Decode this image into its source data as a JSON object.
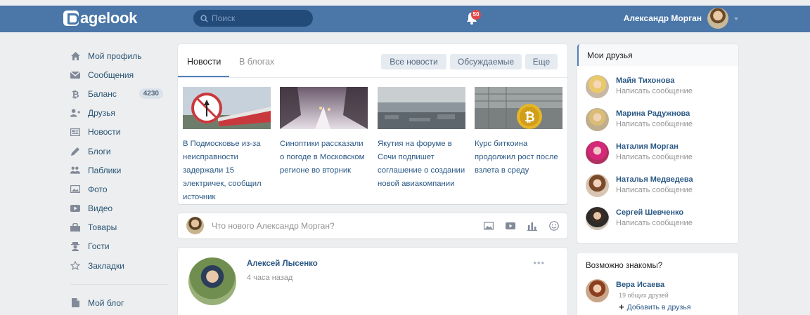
{
  "header": {
    "logo": "agelook",
    "search_placeholder": "Поиск",
    "notifications_count": "50",
    "user_name": "Александр Морган"
  },
  "sidebar": {
    "items": [
      {
        "label": "Мой профиль",
        "icon": "home-icon"
      },
      {
        "label": "Сообщения",
        "icon": "envelope-icon"
      },
      {
        "label": "Баланс",
        "icon": "bitcoin-icon",
        "badge": "4230"
      },
      {
        "label": "Друзья",
        "icon": "add-friend-icon"
      },
      {
        "label": "Новости",
        "icon": "newspaper-icon"
      },
      {
        "label": "Блоги",
        "icon": "pencil-icon"
      },
      {
        "label": "Паблики",
        "icon": "group-icon"
      },
      {
        "label": "Фото",
        "icon": "photo-icon"
      },
      {
        "label": "Видео",
        "icon": "video-icon"
      },
      {
        "label": "Товары",
        "icon": "shopping-bag-icon"
      },
      {
        "label": "Гости",
        "icon": "guest-icon"
      },
      {
        "label": "Закладки",
        "icon": "star-icon"
      }
    ],
    "my_blog": "Мой блог"
  },
  "news": {
    "tabs": [
      "Новости",
      "В блогах"
    ],
    "filters": [
      "Все новости",
      "Обсуждаемые",
      "Еще"
    ],
    "items": [
      {
        "text": "В Подмосковье из-за неисправности задержали 15 электричек, сообщил источник"
      },
      {
        "text": "Синоптики рассказали о погоде в Московском регионе во вторник"
      },
      {
        "text": "Якутия на форуме в Сочи подпишет соглашение о создании новой авиакомпании"
      },
      {
        "text": "Курс биткоина продолжил рост после взлета в среду"
      }
    ]
  },
  "post_box": {
    "placeholder": "Что нового Александр Морган?"
  },
  "feed_post": {
    "author": "Алексей Лысенко",
    "time": "4 часа назад",
    "more": "•••"
  },
  "friends": {
    "title": "Мои друзья",
    "action": "Написать сообщение",
    "list": [
      {
        "name": "Майя Тихонова"
      },
      {
        "name": "Марина Радужнова"
      },
      {
        "name": "Наталия Морган"
      },
      {
        "name": "Наталья Медведева"
      },
      {
        "name": "Сергей Шевченко"
      }
    ]
  },
  "maybe_known": {
    "title": "Возможно знакомы?",
    "name": "Вера Исаева",
    "mutual": "19 общих друзей",
    "add": "Добавить в друзья",
    "add_symbol": "+"
  },
  "colors": {
    "header": "#4a76a8",
    "link": "#2a5885",
    "background": "#edeef0",
    "badge_red": "#e64646"
  }
}
